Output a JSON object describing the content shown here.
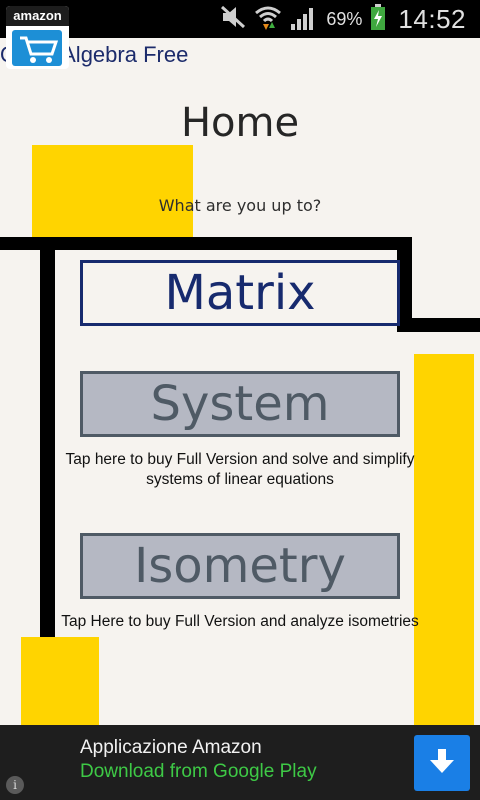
{
  "status_bar": {
    "battery_percent": "69%",
    "time": "14:52",
    "icons": [
      "mute-icon",
      "wifi-icon",
      "signal-icon",
      "battery-charging-icon"
    ]
  },
  "app": {
    "title": "Quick Algebra Free"
  },
  "home": {
    "title": "Home",
    "subtitle": "What are you up to?",
    "buttons": [
      {
        "label": "Matrix"
      },
      {
        "label": "System",
        "note": "Tap here to buy Full Version and solve and simplify systems of linear equations"
      },
      {
        "label": "Isometry",
        "note": "Tap Here to buy Full Version and analyze isometries"
      }
    ]
  },
  "ad": {
    "logo_text": "amazon",
    "title": "Applicazione Amazon",
    "subtitle": "Download from Google Play",
    "icons": [
      "amazon-cart-icon",
      "download-arrow-icon",
      "info-icon"
    ]
  },
  "colors": {
    "background": "#f6f3ef",
    "accent_yellow": "#ffd400",
    "matrix_blue": "#172a6e",
    "disabled_gray": "#b5b8c3",
    "ad_green": "#3ec946",
    "download_blue": "#1a7fe6"
  }
}
